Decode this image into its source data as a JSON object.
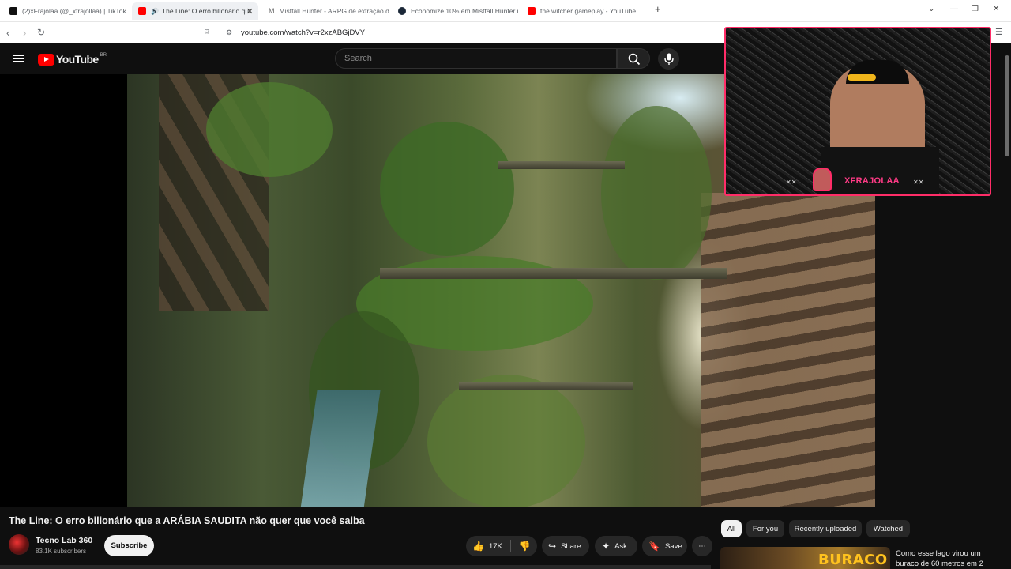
{
  "browser": {
    "tabs": [
      {
        "title": "(2)xFrajolaa (@_xfrajollaa) | TikTok",
        "active": false,
        "favicon": "tiktok-icon"
      },
      {
        "title": "The Line: O erro bilionário qu",
        "active": true,
        "favicon": "youtube-icon"
      },
      {
        "title": "Mistfall Hunter - ARPG de extração d",
        "active": false,
        "favicon": "gmail-icon"
      },
      {
        "title": "Economize 10% em Mistfall Hunter n",
        "active": false,
        "favicon": "steam-icon"
      },
      {
        "title": "the witcher gameplay - YouTube",
        "active": false,
        "favicon": "youtube-icon"
      }
    ],
    "new_tab": "+",
    "url": "youtube.com/watch?v=r2xzABGjDVY"
  },
  "youtube": {
    "logo_text": "YouTube",
    "country": "BR",
    "search_placeholder": "Search"
  },
  "webcam": {
    "name": "XFRAJOLAA",
    "mark": "✕✕"
  },
  "video": {
    "title": "The Line: O erro bilionário que a ARÁBIA SAUDITA não quer que você saiba",
    "channel": "Tecno Lab 360",
    "subscribers": "83.1K subscribers",
    "subscribe": "Subscribe",
    "likes": "17K",
    "share": "Share",
    "ask": "Ask",
    "save": "Save",
    "more": "⋯"
  },
  "chips": [
    "All",
    "For you",
    "Recently uploaded",
    "Watched"
  ],
  "recommendation": {
    "thumb_text": "BURACO",
    "title": "Como esse lago virou um buraco de 60 metros em 2"
  },
  "colors": {
    "accent": "#ff0000",
    "webcam_border": "#ff2d68"
  }
}
